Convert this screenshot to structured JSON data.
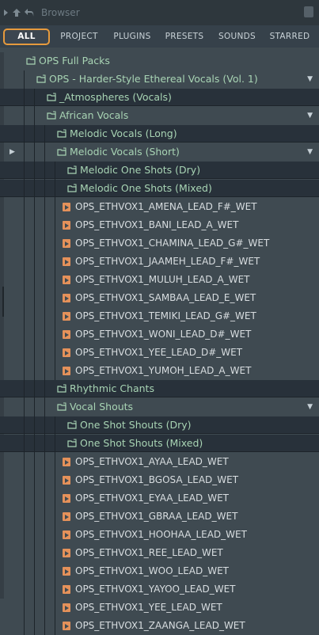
{
  "window": {
    "title": "Browser"
  },
  "tabs": [
    {
      "label": "ALL",
      "active": true
    },
    {
      "label": "PROJECT",
      "active": false
    },
    {
      "label": "PLUGINS",
      "active": false
    },
    {
      "label": "PRESETS",
      "active": false
    },
    {
      "label": "SOUNDS",
      "active": false
    },
    {
      "label": "STARRED",
      "active": false
    }
  ],
  "colors": {
    "accent": "#e69a3d",
    "folder_text": "#a8d4b4",
    "file_icon": "#e4915a",
    "file_text": "#d8dde0"
  },
  "tree": [
    {
      "type": "folder",
      "depth": 0,
      "label": "OPS Full Packs",
      "dark": false
    },
    {
      "type": "folder",
      "depth": 1,
      "label": "OPS - Harder-Style Ethereal Vocals (Vol. 1)",
      "dark": false,
      "arrow": true
    },
    {
      "type": "folder",
      "depth": 2,
      "label": "_Atmospheres (Vocals)",
      "dark": true
    },
    {
      "type": "folder",
      "depth": 2,
      "label": "African Vocals",
      "dark": false,
      "arrow": true
    },
    {
      "type": "folder",
      "depth": 3,
      "label": "Melodic Vocals (Long)",
      "dark": true
    },
    {
      "type": "folder",
      "depth": 3,
      "label": "Melodic Vocals (Short)",
      "dark": false,
      "arrow": true,
      "selected_marker": true
    },
    {
      "type": "folder",
      "depth": 4,
      "label": "Melodic One Shots (Dry)",
      "dark": true
    },
    {
      "type": "folder",
      "depth": 4,
      "label": "Melodic One Shots (Mixed)",
      "dark": true
    },
    {
      "type": "file",
      "depth": 4,
      "label": "OPS_ETHVOX1_AMENA_LEAD_F#_WET"
    },
    {
      "type": "file",
      "depth": 4,
      "label": "OPS_ETHVOX1_BANI_LEAD_A_WET"
    },
    {
      "type": "file",
      "depth": 4,
      "label": "OPS_ETHVOX1_CHAMINA_LEAD_G#_WET"
    },
    {
      "type": "file",
      "depth": 4,
      "label": "OPS_ETHVOX1_JAAMEH_LEAD_F#_WET"
    },
    {
      "type": "file",
      "depth": 4,
      "label": "OPS_ETHVOX1_MULUH_LEAD_A_WET"
    },
    {
      "type": "file",
      "depth": 4,
      "label": "OPS_ETHVOX1_SAMBAA_LEAD_E_WET"
    },
    {
      "type": "file",
      "depth": 4,
      "label": "OPS_ETHVOX1_TEMIKI_LEAD_G#_WET"
    },
    {
      "type": "file",
      "depth": 4,
      "label": "OPS_ETHVOX1_WONI_LEAD_D#_WET"
    },
    {
      "type": "file",
      "depth": 4,
      "label": "OPS_ETHVOX1_YEE_LEAD_D#_WET"
    },
    {
      "type": "file",
      "depth": 4,
      "label": "OPS_ETHVOX1_YUMOH_LEAD_A_WET"
    },
    {
      "type": "folder",
      "depth": 3,
      "label": "Rhythmic Chants",
      "dark": true
    },
    {
      "type": "folder",
      "depth": 3,
      "label": "Vocal Shouts",
      "dark": false,
      "arrow": true
    },
    {
      "type": "folder",
      "depth": 4,
      "label": "One Shot Shouts (Dry)",
      "dark": true
    },
    {
      "type": "folder",
      "depth": 4,
      "label": "One Shot Shouts (Mixed)",
      "dark": true
    },
    {
      "type": "file",
      "depth": 4,
      "label": "OPS_ETHVOX1_AYAA_LEAD_WET"
    },
    {
      "type": "file",
      "depth": 4,
      "label": "OPS_ETHVOX1_BGOSA_LEAD_WET"
    },
    {
      "type": "file",
      "depth": 4,
      "label": "OPS_ETHVOX1_EYAA_LEAD_WET"
    },
    {
      "type": "file",
      "depth": 4,
      "label": "OPS_ETHVOX1_GBRAA_LEAD_WET"
    },
    {
      "type": "file",
      "depth": 4,
      "label": "OPS_ETHVOX1_HOOHAA_LEAD_WET"
    },
    {
      "type": "file",
      "depth": 4,
      "label": "OPS_ETHVOX1_REE_LEAD_WET"
    },
    {
      "type": "file",
      "depth": 4,
      "label": "OPS_ETHVOX1_WOO_LEAD_WET"
    },
    {
      "type": "file",
      "depth": 4,
      "label": "OPS_ETHVOX1_YAYOO_LEAD_WET"
    },
    {
      "type": "file",
      "depth": 4,
      "label": "OPS_ETHVOX1_YEE_LEAD_WET"
    },
    {
      "type": "file",
      "depth": 4,
      "label": "OPS_ETHVOX1_ZAANGA_LEAD_WET"
    }
  ]
}
